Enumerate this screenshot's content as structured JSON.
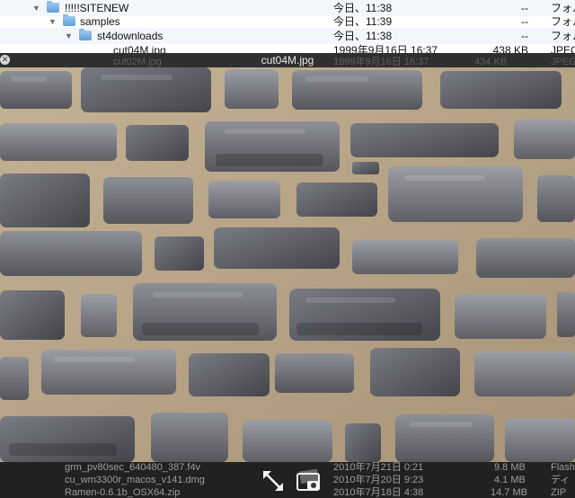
{
  "finder": {
    "rows": [
      {
        "name": "!!!!!SITENEW",
        "date": "今日、11:38",
        "size": "--",
        "kind": "フォル"
      },
      {
        "name": "samples",
        "date": "今日、11:39",
        "size": "--",
        "kind": "フォル"
      },
      {
        "name": "st4downloads",
        "date": "今日、11:38",
        "size": "--",
        "kind": "フォル"
      },
      {
        "name": "cut04M.jpg",
        "date": "1999年9月16日 16:37",
        "size": "438 KB",
        "kind": "JPEG"
      },
      {
        "name": "cut02M.jpg",
        "date": "1999年9月16日 16:37",
        "size": "434 KB",
        "kind": "JPEG"
      }
    ],
    "bottom_rows": [
      {
        "name": "grm_pv80sec_640480_387.f4v",
        "date": "2010年7月21日 0:21",
        "size": "9.8 MB",
        "kind": "Flash"
      },
      {
        "name": "cu_wm3300r_macos_v141.dmg",
        "date": "2010年7月20日 9:23",
        "size": "4.1 MB",
        "kind": "ディ"
      },
      {
        "name": "Ramen-0.6.1b_OSX64.zip",
        "date": "2010年7月18日 4:38",
        "size": "14.7 MB",
        "kind": "ZIP"
      }
    ]
  },
  "quicklook": {
    "title": "cut04M.jpg",
    "close_icon": "close-icon",
    "fullscreen_icon": "fullscreen-arrows-icon",
    "add_to_iphoto_icon": "add-to-iphoto-icon"
  },
  "colors": {
    "mortar": "#b9a58b",
    "stone_dark": "#4c4c52",
    "stone_light": "#8a8c93",
    "folder_blue": "#5f9fd8"
  }
}
